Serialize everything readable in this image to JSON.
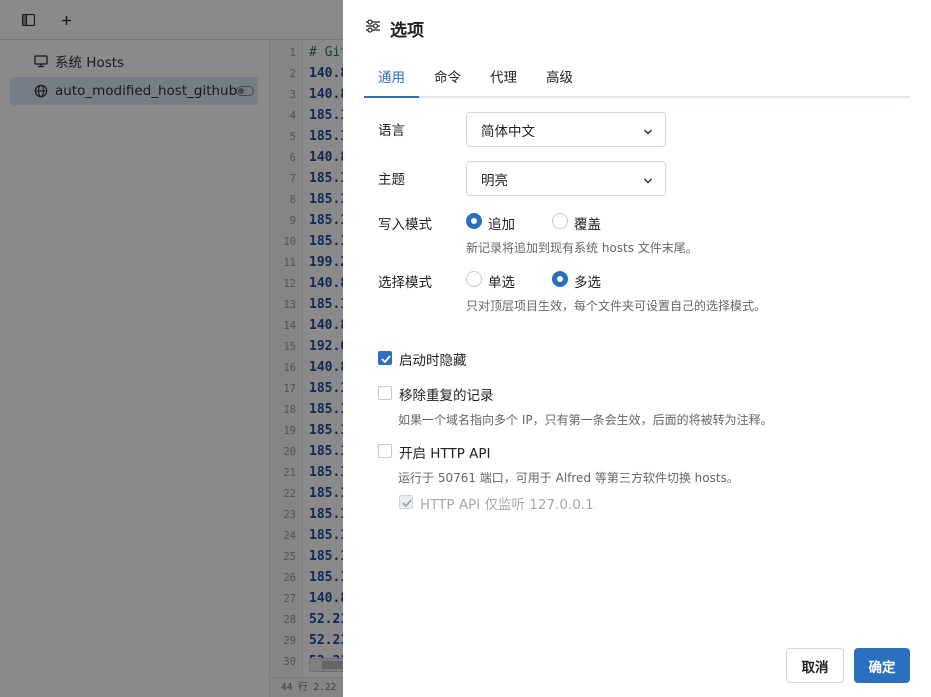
{
  "sidebar": {
    "items": [
      {
        "label": "系统 Hosts",
        "icon": "monitor-icon"
      },
      {
        "label": "auto_modified_host_github",
        "icon": "globe-icon"
      }
    ]
  },
  "editor": {
    "lines": [
      {
        "n": "1",
        "text": "# Git",
        "comment": true
      },
      {
        "n": "2",
        "text": "140.8"
      },
      {
        "n": "3",
        "text": "140.8"
      },
      {
        "n": "4",
        "text": "185.1"
      },
      {
        "n": "5",
        "text": "185.1"
      },
      {
        "n": "6",
        "text": "140.8"
      },
      {
        "n": "7",
        "text": "185.1"
      },
      {
        "n": "8",
        "text": "185.1"
      },
      {
        "n": "9",
        "text": "185.1"
      },
      {
        "n": "10",
        "text": "185.1"
      },
      {
        "n": "11",
        "text": "199.2"
      },
      {
        "n": "12",
        "text": "140.8"
      },
      {
        "n": "13",
        "text": "185.1"
      },
      {
        "n": "14",
        "text": "140.8"
      },
      {
        "n": "15",
        "text": "192.0"
      },
      {
        "n": "16",
        "text": "140.8"
      },
      {
        "n": "17",
        "text": "185.1"
      },
      {
        "n": "18",
        "text": "185.1"
      },
      {
        "n": "19",
        "text": "185.1"
      },
      {
        "n": "20",
        "text": "185.1"
      },
      {
        "n": "21",
        "text": "185.1"
      },
      {
        "n": "22",
        "text": "185.1"
      },
      {
        "n": "23",
        "text": "185.1"
      },
      {
        "n": "24",
        "text": "185.1"
      },
      {
        "n": "25",
        "text": "185.1"
      },
      {
        "n": "26",
        "text": "185.1"
      },
      {
        "n": "27",
        "text": "140.8"
      },
      {
        "n": "28",
        "text": "52.21"
      },
      {
        "n": "29",
        "text": "52.21"
      },
      {
        "n": "30",
        "text": "52.21"
      }
    ],
    "status": "44 行   2.22"
  },
  "drawer": {
    "title": "选项",
    "tabs": [
      "通用",
      "命令",
      "代理",
      "高级"
    ],
    "language": {
      "label": "语言",
      "value": "简体中文"
    },
    "theme": {
      "label": "主题",
      "value": "明亮"
    },
    "write_mode": {
      "label": "写入模式",
      "options": [
        "追加",
        "覆盖"
      ],
      "selected": "追加",
      "help": "新记录将追加到现有系统 hosts 文件末尾。"
    },
    "choice_mode": {
      "label": "选择模式",
      "options": [
        "单选",
        "多选"
      ],
      "selected": "多选",
      "help": "只对顶层项目生效，每个文件夹可设置自己的选择模式。"
    },
    "hide_at_launch": {
      "label": "启动时隐藏",
      "checked": true
    },
    "remove_duplicates": {
      "label": "移除重复的记录",
      "checked": false,
      "help": "如果一个域名指向多个 IP，只有第一条会生效，后面的将被转为注释。"
    },
    "http_api": {
      "label": "开启 HTTP API",
      "checked": false,
      "help": "运行于 50761 端口，可用于 Alfred 等第三方软件切换 hosts。",
      "only_local": {
        "label": "HTTP API 仅监听 127.0.0.1",
        "checked": true,
        "disabled": true
      }
    },
    "buttons": {
      "cancel": "取消",
      "ok": "确定"
    }
  },
  "colors": {
    "accent": "#2c6fbf",
    "overlay": "rgba(0,0,0,0.46)",
    "code": "#1a4d9e",
    "comment": "#2b8a2b"
  }
}
